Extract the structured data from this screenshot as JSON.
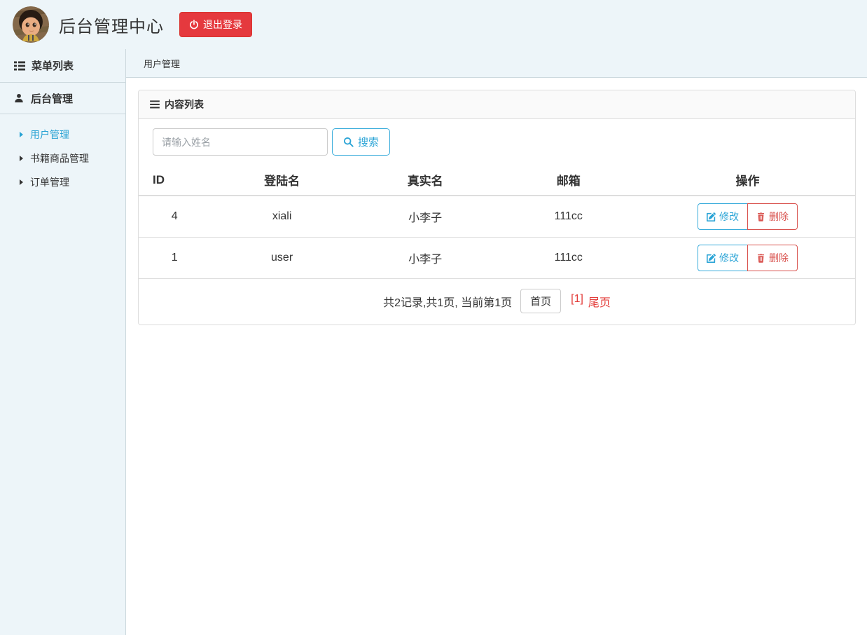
{
  "header": {
    "title": "后台管理中心",
    "logout_label": "退出登录"
  },
  "sidebar": {
    "menu_title": "菜单列表",
    "section_label": "后台管理",
    "items": [
      {
        "label": "用户管理",
        "active": true
      },
      {
        "label": "书籍商品管理",
        "active": false
      },
      {
        "label": "订单管理",
        "active": false
      }
    ]
  },
  "breadcrumb": {
    "label": "用户管理"
  },
  "panel": {
    "title": "内容列表",
    "search": {
      "placeholder": "请输入姓名",
      "button_label": "搜索"
    }
  },
  "table": {
    "columns": [
      "ID",
      "登陆名",
      "真实名",
      "邮箱",
      "操作"
    ],
    "rows": [
      {
        "id": "4",
        "login": "xiali",
        "real_name": "小李子",
        "email": "111cc"
      },
      {
        "id": "1",
        "login": "user",
        "real_name": "小李子",
        "email": "111cc"
      }
    ],
    "edit_label": "修改",
    "delete_label": "删除"
  },
  "pagination": {
    "summary": "共2记录,共1页, 当前第1页",
    "first_label": "首页",
    "current_page": "[1]",
    "last_label": "尾页"
  },
  "colors": {
    "accent_cyan": "#2ba4d6",
    "accent_cyan_border": "#39acdb",
    "sidebar_active": "#29a3d4",
    "logout_red": "#e5393e",
    "delete_red": "#d9534f",
    "pagination_red": "#e33b38",
    "light_blue_bg": "#edf5f9",
    "panel_border": "#dddddd"
  }
}
